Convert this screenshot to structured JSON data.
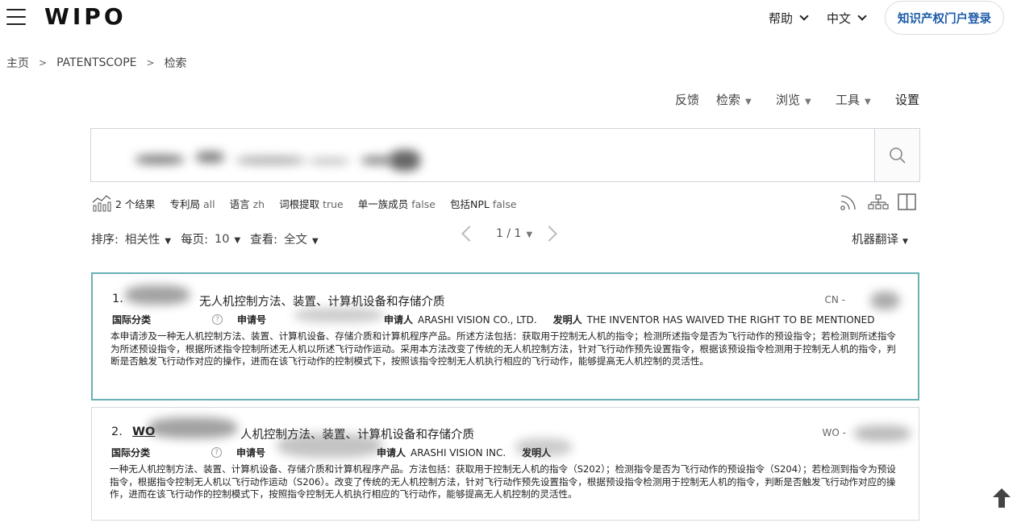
{
  "header": {
    "logo": "WIPO",
    "help_label": "帮助",
    "language_label": "中文",
    "login_label": "知识产权门户登录"
  },
  "breadcrumb": [
    "主页",
    "PATENTSCOPE",
    "检索"
  ],
  "topmenu": {
    "feedback": "反馈",
    "search": "检索",
    "browse": "浏览",
    "tools": "工具",
    "settings": "设置"
  },
  "summary": {
    "results": "2 个结果",
    "office_label": "专利局",
    "office_value": "all",
    "language_label": "语言",
    "language_value": "zh",
    "stemming_label": "词根提取",
    "stemming_value": "true",
    "single_family_label": "单一族成员",
    "single_family_value": "false",
    "npl_label": "包括NPL",
    "npl_value": "false"
  },
  "controls": {
    "sort_label": "排序:",
    "sort_value": "相关性",
    "per_page_label": "每页:",
    "per_page_value": "10",
    "view_label": "查看:",
    "view_value": "全文",
    "page_indicator": "1 / 1",
    "machine_translation": "机器翻译"
  },
  "results": [
    {
      "number": "1.",
      "title": "无人机控制方法、装置、计算机设备和存储介质",
      "office": "CN -",
      "ipc_label": "国际分类",
      "appno_label": "申请号",
      "applicant_label": "申请人",
      "applicant": "ARASHI VISION CO., LTD.",
      "inventor_label": "发明人",
      "inventor": "THE INVENTOR HAS WAIVED THE RIGHT TO BE MENTIONED",
      "abstract": "本申请涉及一种无人机控制方法、装置、计算机设备、存储介质和计算机程序产品。所述方法包括：获取用于控制无人机的指令；检测所述指令是否为飞行动作的预设指令；若检测到所述指令为所述预设指令，根据所述指令控制所述无人机以所述飞行动作运动。采用本方法改变了传统的无人机控制方法，针对飞行动作预先设置指令，根据该预设指令检测用于控制无人机的指令，判断是否触发飞行动作对应的操作，进而在该飞行动作的控制模式下，按照该指令控制无人机执行相应的飞行动作，能够提高无人机控制的灵活性。"
    },
    {
      "number": "2.",
      "title_prefix": "WO",
      "title": "人机控制方法、装置、计算机设备和存储介质",
      "office": "WO -",
      "ipc_label": "国际分类",
      "appno_label": "申请号",
      "applicant_label": "申请人",
      "applicant": "ARASHI VISION INC.",
      "inventor_label": "发明人",
      "inventor": "",
      "abstract": "一种无人机控制方法、装置、计算机设备、存储介质和计算机程序产品。方法包括：获取用于控制无人机的指令（S202）；检测指令是否为飞行动作的预设指令（S204）；若检测到指令为预设指令，根据指令控制无人机以飞行动作运动（S206）。改变了传统的无人机控制方法，针对飞行动作预先设置指令，根据预设指令检测用于控制无人机的指令，判断是否触发飞行动作对应的操作，进而在该飞行动作的控制模式下，按照指令控制无人机执行相应的飞行动作，能够提高无人机控制的灵活性。"
    }
  ],
  "icons": {
    "menu": "hamburger-menu-icon",
    "search": "search-icon",
    "stats": "bar-chart-icon",
    "rss": "rss-feed-icon",
    "tree": "hierarchy-icon",
    "split": "split-view-icon",
    "scroll_top": "arrow-up-icon"
  }
}
